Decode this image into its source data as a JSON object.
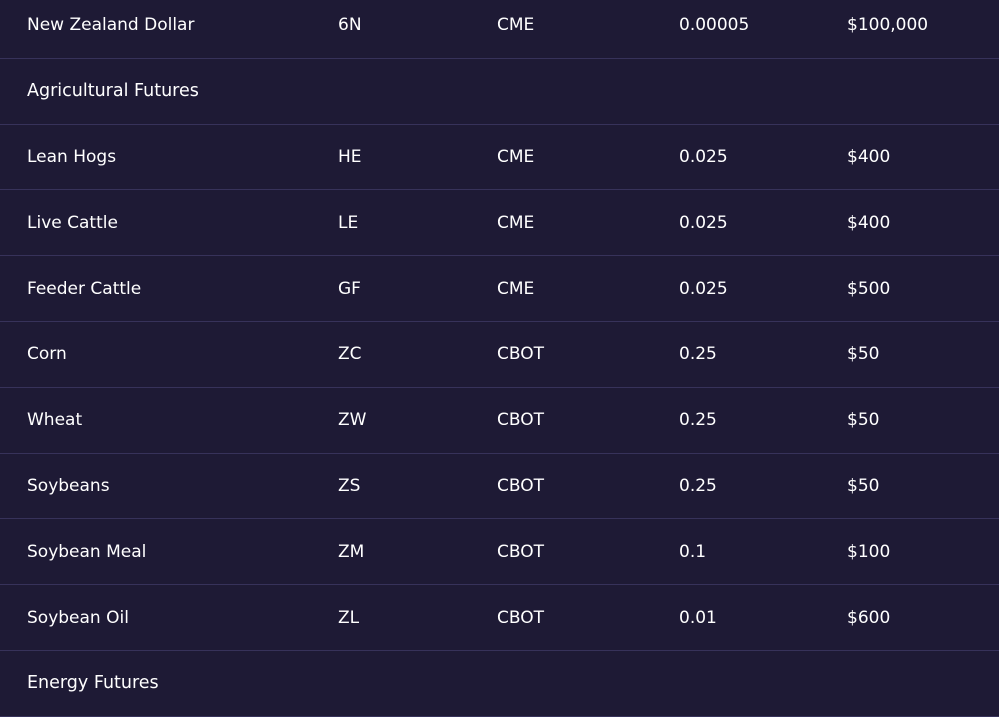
{
  "rows": [
    {
      "type": "data",
      "name": "New Zealand Dollar",
      "symbol": "6N",
      "exchange": "CME",
      "tick": "0.00005",
      "value": "$100,000"
    },
    {
      "type": "section",
      "name": "Agricultural Futures"
    },
    {
      "type": "data",
      "name": "Lean Hogs",
      "symbol": "HE",
      "exchange": "CME",
      "tick": "0.025",
      "value": "$400"
    },
    {
      "type": "data",
      "name": "Live Cattle",
      "symbol": "LE",
      "exchange": "CME",
      "tick": "0.025",
      "value": "$400"
    },
    {
      "type": "data",
      "name": "Feeder Cattle",
      "symbol": "GF",
      "exchange": "CME",
      "tick": "0.025",
      "value": "$500"
    },
    {
      "type": "data",
      "name": "Corn",
      "symbol": "ZC",
      "exchange": "CBOT",
      "tick": "0.25",
      "value": "$50"
    },
    {
      "type": "data",
      "name": "Wheat",
      "symbol": "ZW",
      "exchange": "CBOT",
      "tick": "0.25",
      "value": "$50"
    },
    {
      "type": "data",
      "name": "Soybeans",
      "symbol": "ZS",
      "exchange": "CBOT",
      "tick": "0.25",
      "value": "$50"
    },
    {
      "type": "data",
      "name": "Soybean Meal",
      "symbol": "ZM",
      "exchange": "CBOT",
      "tick": "0.1",
      "value": "$100"
    },
    {
      "type": "data",
      "name": "Soybean Oil",
      "symbol": "ZL",
      "exchange": "CBOT",
      "tick": "0.01",
      "value": "$600"
    },
    {
      "type": "section",
      "name": "Energy Futures"
    }
  ]
}
